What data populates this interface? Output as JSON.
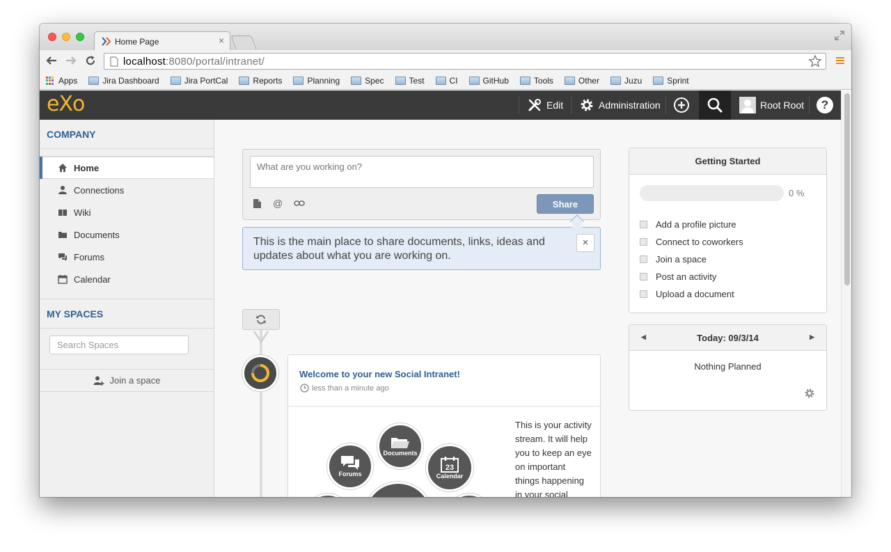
{
  "browser": {
    "tab_title": "Home Page",
    "tab_close": "×",
    "url_host": "localhost",
    "url_rest": ":8080/portal/intranet/",
    "bookmarks": [
      "Apps",
      "Jira Dashboard",
      "Jira PortCal",
      "Reports",
      "Planning",
      "Spec",
      "Test",
      "CI",
      "GitHub",
      "Tools",
      "Other",
      "Juzu",
      "Sprint"
    ]
  },
  "topbar": {
    "logo": "eXo",
    "edit_label": "Edit",
    "admin_label": "Administration",
    "user_name": "Root Root",
    "help_label": "?"
  },
  "sidebar": {
    "company_header": "COMPANY",
    "items": [
      {
        "label": "Home",
        "icon": "home-icon"
      },
      {
        "label": "Connections",
        "icon": "user-icon"
      },
      {
        "label": "Wiki",
        "icon": "book-icon"
      },
      {
        "label": "Documents",
        "icon": "folder-icon"
      },
      {
        "label": "Forums",
        "icon": "chat-icon"
      },
      {
        "label": "Calendar",
        "icon": "calendar-icon"
      }
    ],
    "spaces_header": "MY SPACES",
    "search_placeholder": "Search Spaces",
    "join_label": "Join a space"
  },
  "composer": {
    "placeholder": "What are you working on?",
    "share_label": "Share",
    "tip_text": "This is the main place to share documents, links, ideas and updates about what you are working on.",
    "tip_close": "×"
  },
  "activity": {
    "title": "Welcome to your new Social Intranet!",
    "time": "less than a minute ago",
    "text": "This is your activity stream. It will help you to keep an eye on important things happening in your social intranet.",
    "bubbles": {
      "documents": "Documents",
      "forums": "Forums",
      "calendar": "Calendar",
      "calendar_day": "23"
    }
  },
  "getting_started": {
    "title": "Getting Started",
    "progress": 0,
    "percent_label": "0 %",
    "tasks": [
      "Add a profile picture",
      "Connect to coworkers",
      "Join a space",
      "Post an activity",
      "Upload a document"
    ]
  },
  "calendar": {
    "title": "Today: 09/3/14",
    "empty": "Nothing Planned"
  },
  "colors": {
    "brand": "#f2b632",
    "link": "#2f5e92",
    "share": "#7c97ba",
    "tip": "#e3ecf7"
  }
}
